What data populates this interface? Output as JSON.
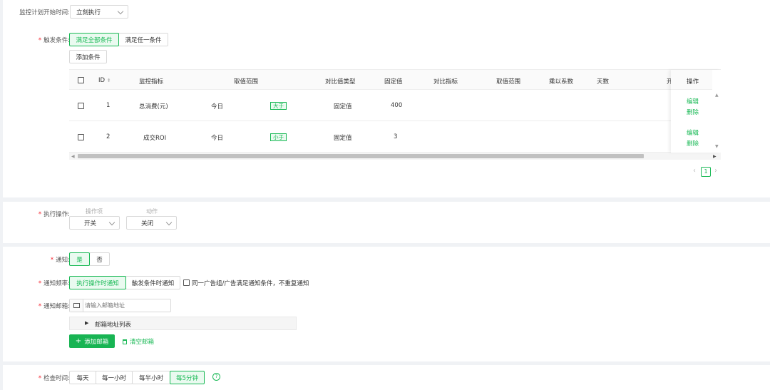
{
  "schedule": {
    "start_time_label": "监控计划开始时间:",
    "start_time_value": "立刻执行"
  },
  "trigger": {
    "label": "触发条件:",
    "options": [
      "满足全部条件",
      "满足任一条件"
    ],
    "active_index": 0,
    "add_condition": "添加条件"
  },
  "table": {
    "columns": [
      "ID",
      "监控指标",
      "取值范围",
      "对比值类型",
      "固定值",
      "对比指标",
      "取值范围",
      "乘以系数",
      "天数",
      "开",
      "操作"
    ],
    "rows": [
      {
        "id": "1",
        "metric": "总消费(元)",
        "range": "今日",
        "op": "大于",
        "compare_type": "固定值",
        "fixed": "400",
        "actions": [
          "编辑",
          "删除"
        ]
      },
      {
        "id": "2",
        "metric": "成交ROI",
        "range": "今日",
        "op": "小于",
        "compare_type": "固定值",
        "fixed": "3",
        "actions": [
          "编辑",
          "删除"
        ]
      }
    ],
    "page": "1"
  },
  "action": {
    "label": "执行操作:",
    "col1_label": "操作项",
    "col1_value": "开关",
    "col2_label": "动作",
    "col2_value": "关闭"
  },
  "notify": {
    "label": "通知:",
    "options": [
      "是",
      "否"
    ],
    "active_index": 0,
    "freq_label": "通知频率:",
    "freq_options": [
      "执行操作时通知",
      "触发条件时通知"
    ],
    "freq_active": 0,
    "dedupe_text": "同一广告组/广告满足通知条件，不重复通知",
    "email_label": "通知邮箱:",
    "email_placeholder": "请输入邮箱地址",
    "list_label": "邮箱地址列表",
    "add_email": "添加邮箱",
    "clear_email": "清空邮箱"
  },
  "check": {
    "label": "检查时间:",
    "options": [
      "每天",
      "每一小时",
      "每半小时",
      "每5分钟"
    ],
    "active_index": 3
  },
  "colors": {
    "accent": "#19b955",
    "required": "#f5222d"
  }
}
